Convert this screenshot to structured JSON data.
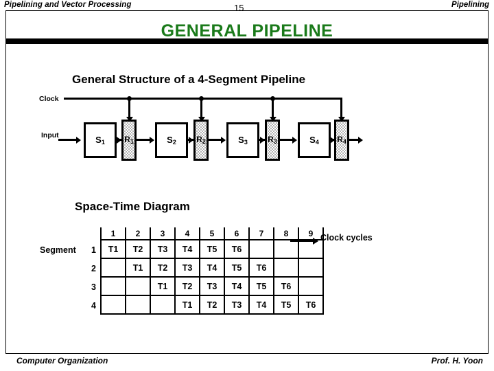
{
  "header": {
    "left_title": "Pipelining and Vector Processing",
    "page_number": "15",
    "right_title": "Pipelining"
  },
  "slide": {
    "title": "GENERAL  PIPELINE",
    "title_color": "#1a7a1a"
  },
  "structure_section": {
    "heading": "General Structure of a 4-Segment Pipeline",
    "clock_label": "Clock",
    "input_label": "Input",
    "segments": [
      {
        "letter": "S",
        "sub": "1"
      },
      {
        "letter": "S",
        "sub": "2"
      },
      {
        "letter": "S",
        "sub": "3"
      },
      {
        "letter": "S",
        "sub": "4"
      }
    ],
    "registers": [
      {
        "letter": "R",
        "sub": "1"
      },
      {
        "letter": "R",
        "sub": "2"
      },
      {
        "letter": "R",
        "sub": "3"
      },
      {
        "letter": "R",
        "sub": "4"
      }
    ]
  },
  "spacetime_section": {
    "heading": "Space-Time Diagram",
    "segment_label": "Segment",
    "clock_cycles_label": "Clock cycles",
    "row_labels": [
      "1",
      "2",
      "3",
      "4"
    ],
    "column_headers": [
      "1",
      "2",
      "3",
      "4",
      "5",
      "6",
      "7",
      "8",
      "9"
    ],
    "rows": [
      [
        "T1",
        "T2",
        "T3",
        "T4",
        "T5",
        "T6",
        "",
        "",
        ""
      ],
      [
        "",
        "T1",
        "T2",
        "T3",
        "T4",
        "T5",
        "T6",
        "",
        ""
      ],
      [
        "",
        "",
        "T1",
        "T2",
        "T3",
        "T4",
        "T5",
        "T6",
        ""
      ],
      [
        "",
        "",
        "",
        "T1",
        "T2",
        "T3",
        "T4",
        "T5",
        "T6"
      ]
    ]
  },
  "footer": {
    "left": "Computer Organization",
    "right": "Prof.  H. Yoon"
  }
}
